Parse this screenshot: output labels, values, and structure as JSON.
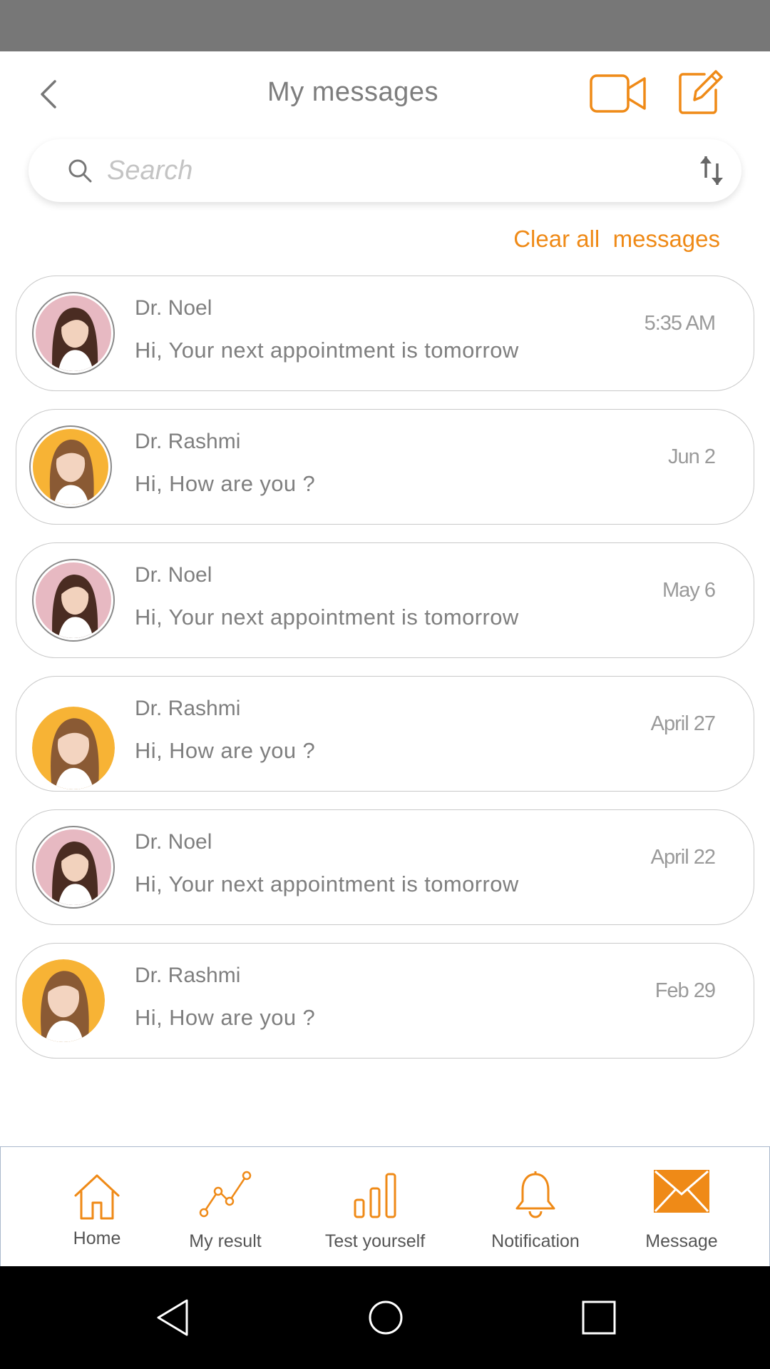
{
  "header": {
    "title": "My messages"
  },
  "search": {
    "placeholder": "Search"
  },
  "actions": {
    "clear_all": "Clear all  messages"
  },
  "messages": [
    {
      "sender": "Dr. Noel",
      "preview": "Hi, Your next appointment is tomorrow",
      "time": "5:35 AM",
      "avatar": "avatar-noel"
    },
    {
      "sender": "Dr. Rashmi",
      "preview": "Hi, How are you ?",
      "time": "Jun 2",
      "avatar": "avatar-rashmi"
    },
    {
      "sender": "Dr. Noel",
      "preview": "Hi, Your next appointment is tomorrow",
      "time": "May 6",
      "avatar": "avatar-noel"
    },
    {
      "sender": "Dr. Rashmi",
      "preview": "Hi, How are you ?",
      "time": "April 27",
      "avatar": "avatar-rashmi"
    },
    {
      "sender": "Dr. Noel",
      "preview": "Hi, Your next appointment is tomorrow",
      "time": "April 22",
      "avatar": "avatar-noel"
    },
    {
      "sender": "Dr. Rashmi",
      "preview": "Hi, How are you ?",
      "time": "Feb 29",
      "avatar": "avatar-rashmi"
    }
  ],
  "bottom_nav": {
    "items": [
      {
        "label": "Home",
        "icon": "home-icon"
      },
      {
        "label": "My result",
        "icon": "chart-line-icon"
      },
      {
        "label": "Test yourself",
        "icon": "bar-chart-icon"
      },
      {
        "label": "Notification",
        "icon": "bell-icon"
      },
      {
        "label": "Message",
        "icon": "envelope-icon"
      }
    ]
  },
  "colors": {
    "accent": "#ef8a17",
    "status_bar": "#777777",
    "system_bar": "#000000"
  }
}
